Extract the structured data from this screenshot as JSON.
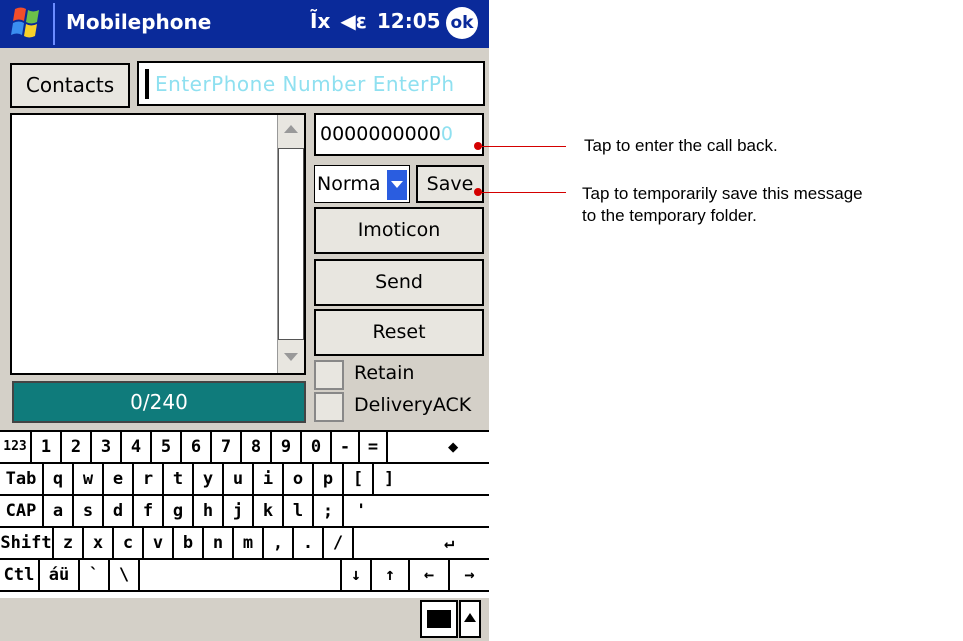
{
  "titlebar": {
    "app_title": "Mobilephone",
    "signal": "Ĩx",
    "volume": "◀ε",
    "time": "12:05",
    "ok_label": "ok"
  },
  "compose": {
    "contacts_label": "Contacts",
    "phone_placeholder": "EnterPhone Number  EnterPh",
    "callback_value": "0000000000",
    "callback_tail": "0",
    "priority_value": "Norma",
    "save_label": "Save",
    "imoticon_label": "Imoticon",
    "send_label": "Send",
    "reset_label": "Reset",
    "retain_label": "Retain",
    "delivery_label": "DeliveryACK",
    "counter": "0/240"
  },
  "keyboard": {
    "rows": [
      [
        "123",
        "1",
        "2",
        "3",
        "4",
        "5",
        "6",
        "7",
        "8",
        "9",
        "0",
        "-",
        "=",
        "◆"
      ],
      [
        "Tab",
        "q",
        "w",
        "e",
        "r",
        "t",
        "y",
        "u",
        "i",
        "o",
        "p",
        "[",
        "]"
      ],
      [
        "CAP",
        "a",
        "s",
        "d",
        "f",
        "g",
        "h",
        "j",
        "k",
        "l",
        ";",
        "'"
      ],
      [
        "Shift",
        "z",
        "x",
        "c",
        "v",
        "b",
        "n",
        "m",
        ",",
        ".",
        "/",
        "↵"
      ],
      [
        "Ctl",
        "áü",
        "`",
        "\\",
        "",
        "↓",
        "↑",
        "←",
        "→"
      ]
    ]
  },
  "callouts": {
    "callback_note": "Tap to enter the call back.",
    "save_note_line1": "Tap to temporarily save this message",
    "save_note_line2": "to the temporary folder."
  },
  "colors": {
    "titlebar": "#0a2a9a",
    "counter_bg": "#0f7b7b",
    "callout": "#d40000"
  }
}
